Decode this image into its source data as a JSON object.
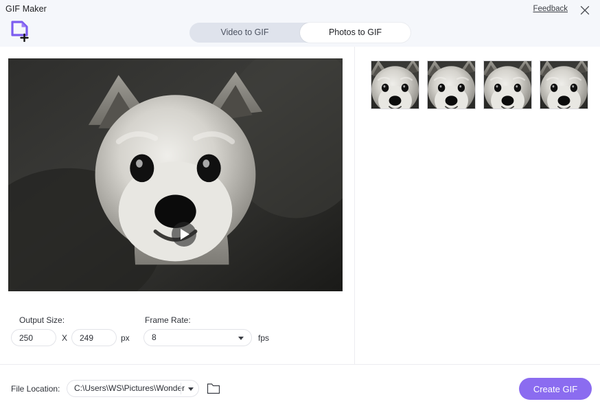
{
  "window": {
    "title": "GIF Maker",
    "feedback_label": "Feedback",
    "close_icon": "close-icon"
  },
  "header": {
    "add_file_icon": "add-file-icon",
    "tabs": [
      {
        "label": "Video to GIF",
        "active": false
      },
      {
        "label": "Photos to GIF",
        "active": true
      }
    ]
  },
  "preview": {
    "play_icon": "play-icon",
    "media_alt": "dog-preview"
  },
  "thumbnails": [
    {
      "alt": "dog-frame-1"
    },
    {
      "alt": "dog-frame-2"
    },
    {
      "alt": "dog-frame-3"
    },
    {
      "alt": "dog-frame-4"
    }
  ],
  "settings": {
    "output_size_label": "Output Size:",
    "width_value": "250",
    "separator": "X",
    "height_value": "249",
    "size_unit": "px",
    "frame_rate_label": "Frame Rate:",
    "frame_rate_value": "8",
    "frame_rate_unit": "fps"
  },
  "footer": {
    "file_location_label": "File Location:",
    "file_location_value": "C:\\Users\\WS\\Pictures\\Wonder",
    "folder_icon": "folder-icon",
    "create_button_label": "Create GIF"
  },
  "colors": {
    "accent": "#8b6cf0",
    "header_bg": "#f5f7fb",
    "segment_bg": "#dfe3ec",
    "divider": "#ececf0"
  }
}
